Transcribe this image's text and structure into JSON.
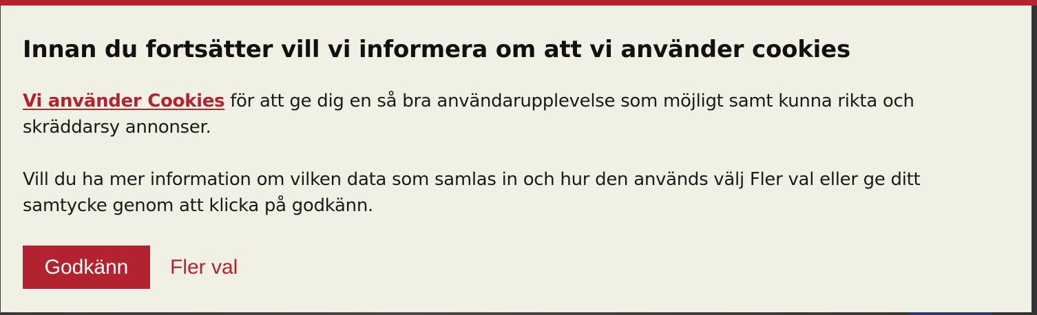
{
  "dialog": {
    "title": "Innan du fortsätter vill vi informera om att vi använder cookies",
    "paragraph1": {
      "link_text": "Vi använder Cookies",
      "rest": " för att ge dig en så bra användarupplevelse som möjligt samt kunna rikta och skräddarsy annonser."
    },
    "paragraph2": "Vill du ha mer information om vilken data som samlas in och hur den används välj Fler val eller ge ditt samtycke genom att klicka på godkänn.",
    "accept_label": "Godkänn",
    "more_options_label": "Fler val"
  },
  "colors": {
    "accent": "#b2222f",
    "background": "#f1f0e5",
    "text": "#1a1a1a"
  }
}
